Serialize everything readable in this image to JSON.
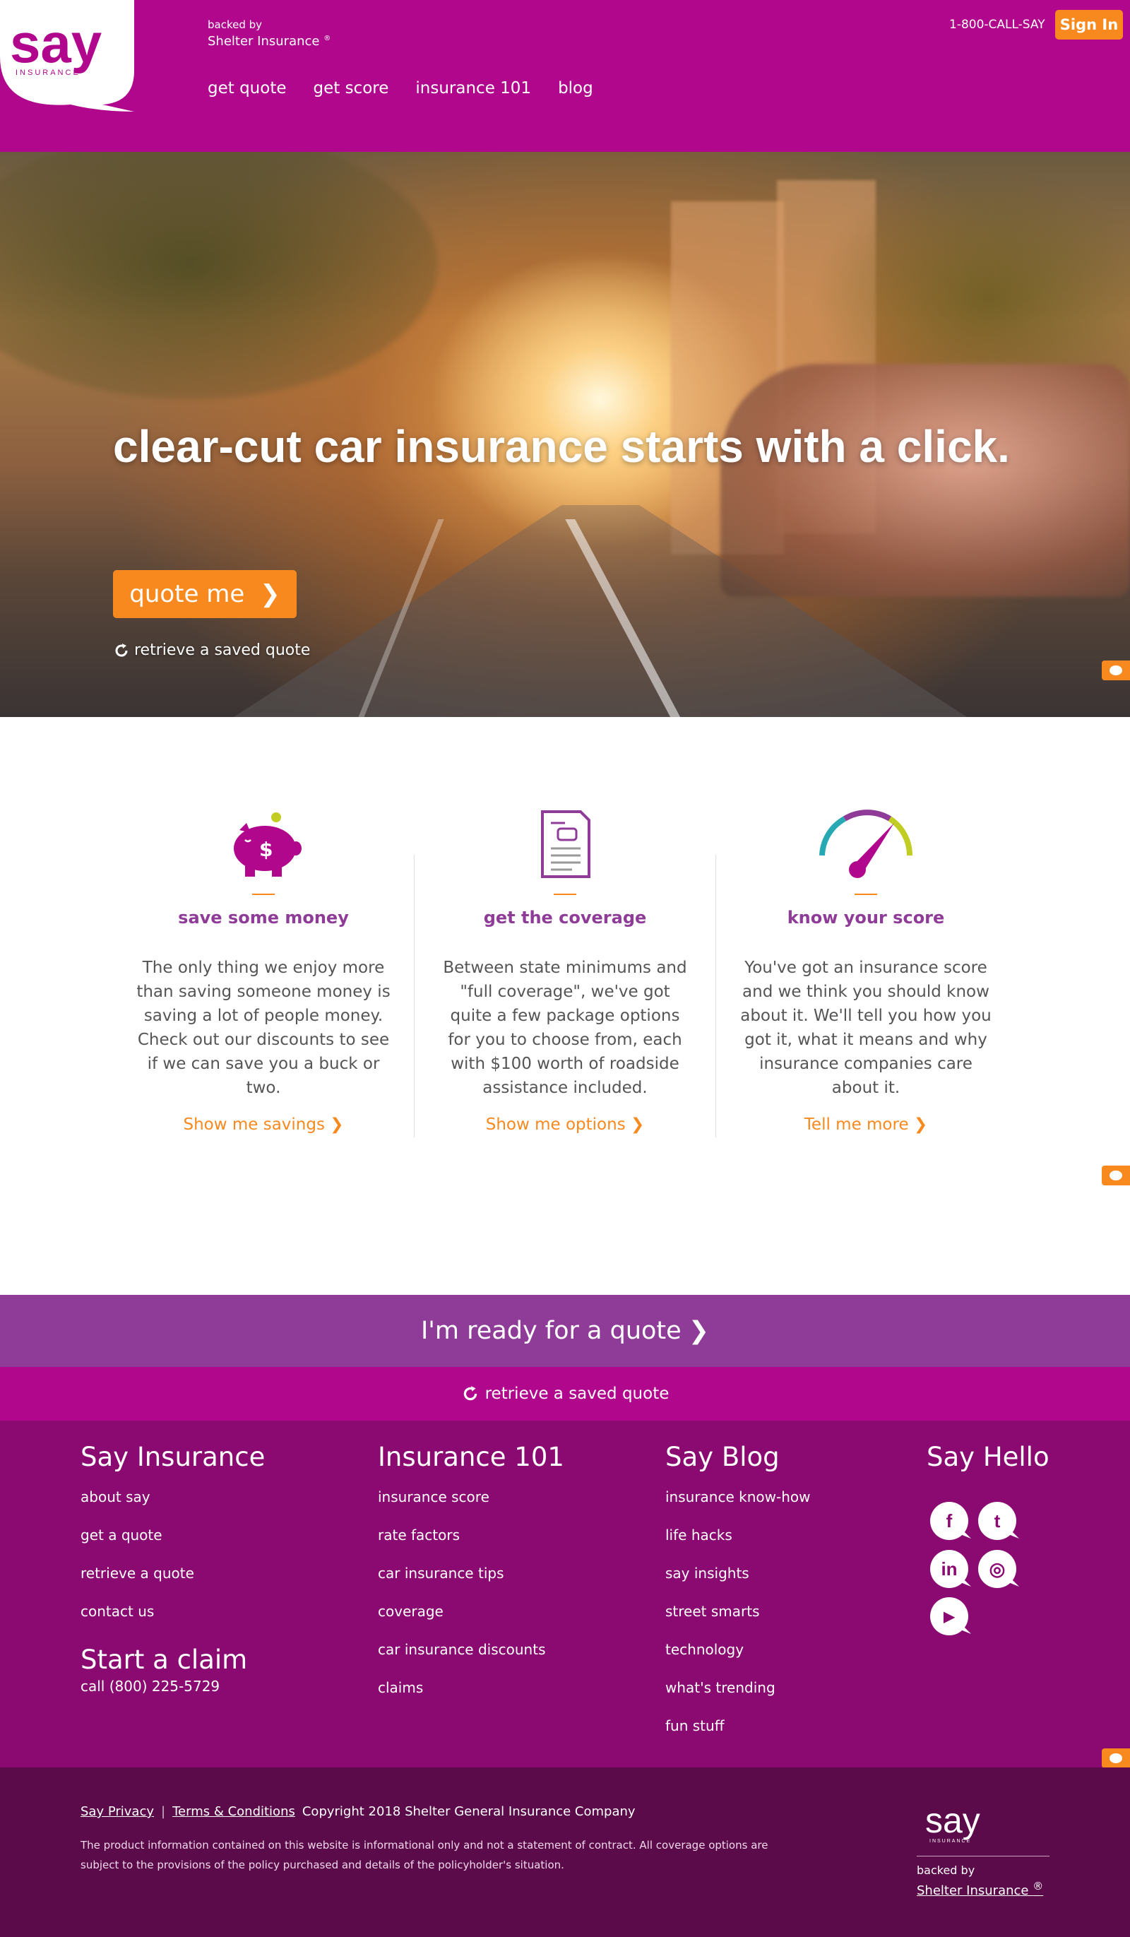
{
  "header": {
    "logo_text": "say",
    "logo_subtext": "INSURANCE",
    "backed_by": "backed by",
    "backer_name": "Shelter Insurance",
    "registered_mark": "®",
    "nav": [
      "get quote",
      "get score",
      "insurance 101",
      "blog"
    ],
    "phone": "1-800-CALL-SAY",
    "sign_in": "Sign In"
  },
  "hero": {
    "headline": "clear-cut car insurance starts with a click.",
    "cta_label": "quote me",
    "cta_chevron": "❯",
    "retrieve_label": "retrieve a saved quote"
  },
  "features": [
    {
      "icon": "piggy-bank-icon",
      "title": "save some money",
      "body": "The only thing we enjoy more than saving someone money is saving a lot of people money. Check out our discounts to see if we can save you a buck or two.",
      "link": "Show me savings ❯"
    },
    {
      "icon": "policy-document-icon",
      "title": "get the coverage",
      "body": "Between state minimums and \"full coverage\", we've got quite a few package options for you to choose from, each with $100 worth of roadside assistance included.",
      "link": "Show me options ❯"
    },
    {
      "icon": "gauge-icon",
      "title": "know your score",
      "body": "You've got an insurance score and we think you should know about it. We'll tell you how you got it, what it means and why insurance companies care about it.",
      "link": "Tell me more ❯"
    }
  ],
  "quote_band": {
    "ready_label": "I'm ready for a quote",
    "chevron": "❯",
    "retrieve_label": "retrieve a saved quote"
  },
  "footer": {
    "say_insurance": {
      "title": "Say Insurance",
      "links": [
        "about say",
        "get a quote",
        "retrieve a quote",
        "contact us"
      ],
      "claim_title": "Start a claim",
      "claim_phone": "call (800) 225-5729"
    },
    "insurance_101": {
      "title": "Insurance 101",
      "links": [
        "insurance score",
        "rate factors",
        "car insurance tips",
        "coverage",
        "car insurance discounts",
        "claims"
      ]
    },
    "say_blog": {
      "title": "Say Blog",
      "links": [
        "insurance know-how",
        "life hacks",
        "say insights",
        "street smarts",
        "technology",
        "what's trending",
        "fun stuff"
      ]
    },
    "say_hello": {
      "title": "Say Hello",
      "social": [
        {
          "icon": "facebook-icon",
          "glyph": "f"
        },
        {
          "icon": "twitter-icon",
          "glyph": "t"
        },
        {
          "icon": "linkedin-icon",
          "glyph": "in"
        },
        {
          "icon": "instagram-icon",
          "glyph": "◎"
        },
        {
          "icon": "youtube-icon",
          "glyph": "▶"
        }
      ]
    }
  },
  "legal": {
    "privacy": "Say Privacy",
    "separator": "|",
    "terms": "Terms & Conditions",
    "copyright": "Copyright 2018 Shelter General Insurance Company",
    "fine_print": "The product information contained on this website is informational only and not a statement of contract. All coverage options are subject to the provisions of the policy purchased and details of the policyholder's situation.",
    "logo_text": "say",
    "logo_subtext": "INSURANCE",
    "backed_by": "backed by",
    "backer_name": "Shelter Insurance",
    "registered_mark": "®"
  },
  "colors": {
    "brand_magenta": "#b0078d",
    "brand_purple": "#8e3c98",
    "accent_orange": "#f8891f",
    "footer_purple": "#8a0a71",
    "legal_purple": "#5b0a4a"
  }
}
